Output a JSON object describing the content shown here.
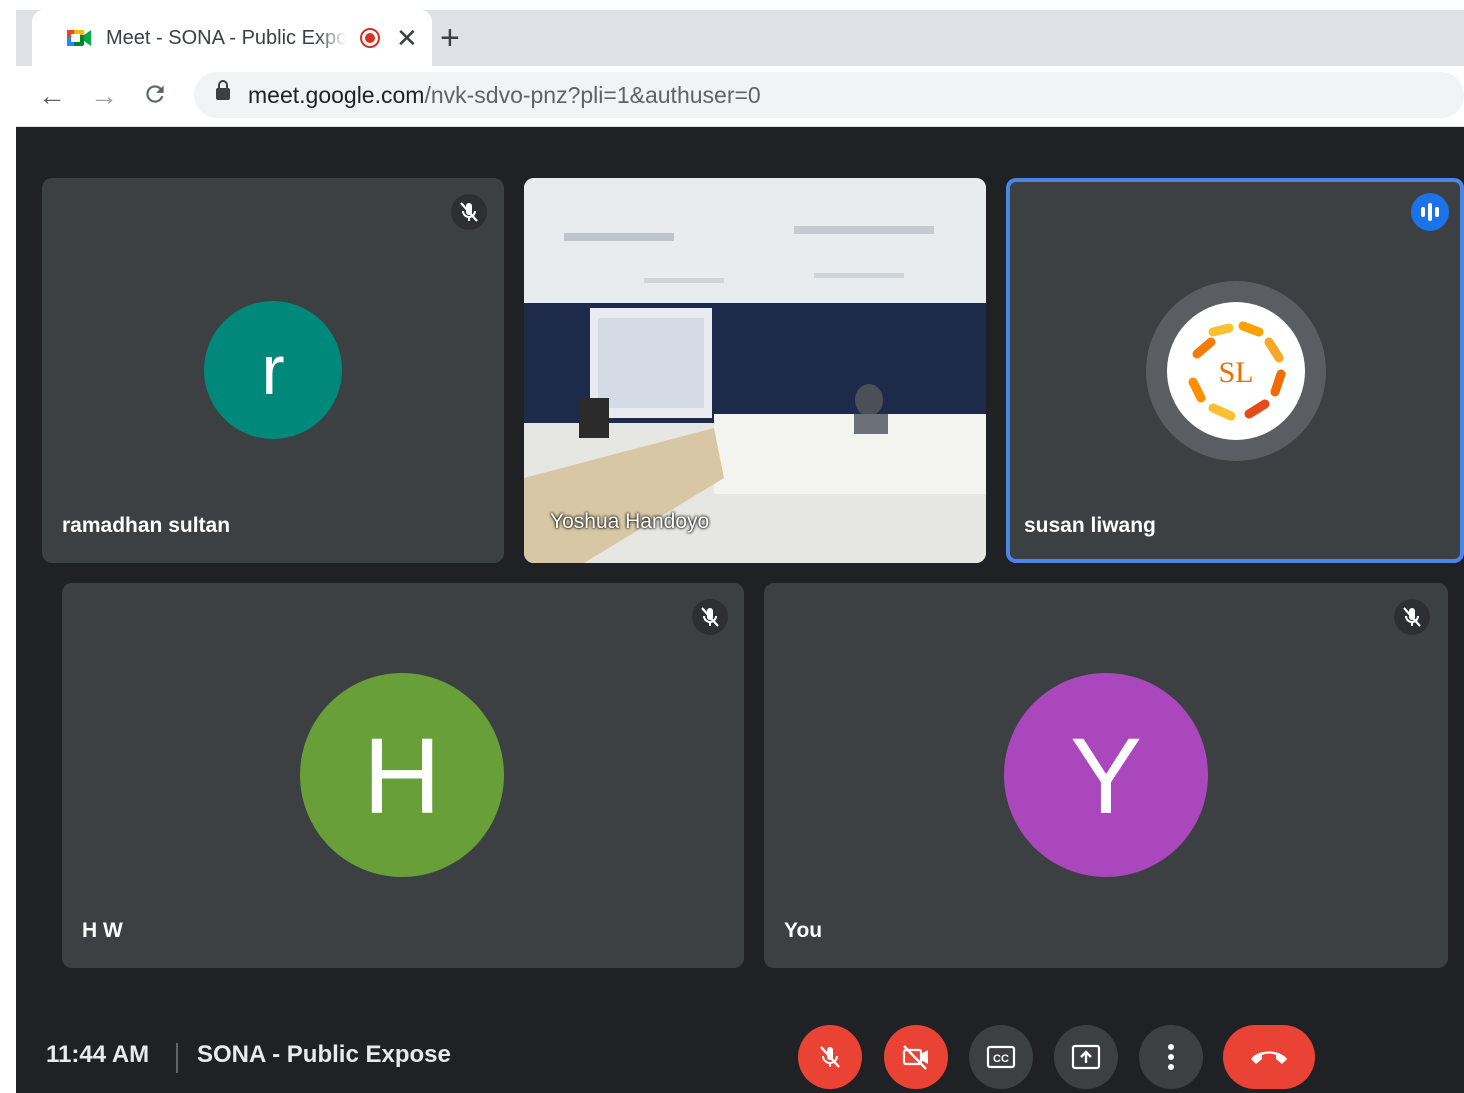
{
  "browser": {
    "tab": {
      "title": "Meet - SONA - Public Expose",
      "close_glyph": "✕"
    },
    "new_tab_glyph": "+",
    "nav": {
      "back": "←",
      "forward": "→",
      "reload": "C"
    },
    "address": {
      "host": "meet.google.com",
      "path": "/nvk-sdvo-pnz?pli=1&authuser=0"
    }
  },
  "meet": {
    "participants": [
      {
        "name": "ramadhan sultan",
        "initial": "r",
        "avatar_color": "#00897b",
        "muted": true
      },
      {
        "name": "Yoshua Handoyo",
        "video": "conference-room-camera-feed"
      },
      {
        "name": "susan liwang",
        "avatar_logo_text": "SL",
        "speaking": true
      },
      {
        "name": "H W",
        "initial": "H",
        "avatar_color": "#689f38",
        "muted": true
      },
      {
        "name": "You",
        "initial": "Y",
        "avatar_color": "#ab47bc",
        "muted": true
      }
    ],
    "bottom_bar": {
      "time": "11:44 AM",
      "meeting_title": "SONA - Public Expose",
      "controls": [
        "mic-off",
        "camera-off",
        "captions",
        "present-now",
        "more-options",
        "leave-call"
      ]
    }
  },
  "colors": {
    "meet_bg": "#202124",
    "tile_bg": "#3c4043",
    "danger": "#ea4335",
    "speaking_border": "#4a86e8"
  }
}
